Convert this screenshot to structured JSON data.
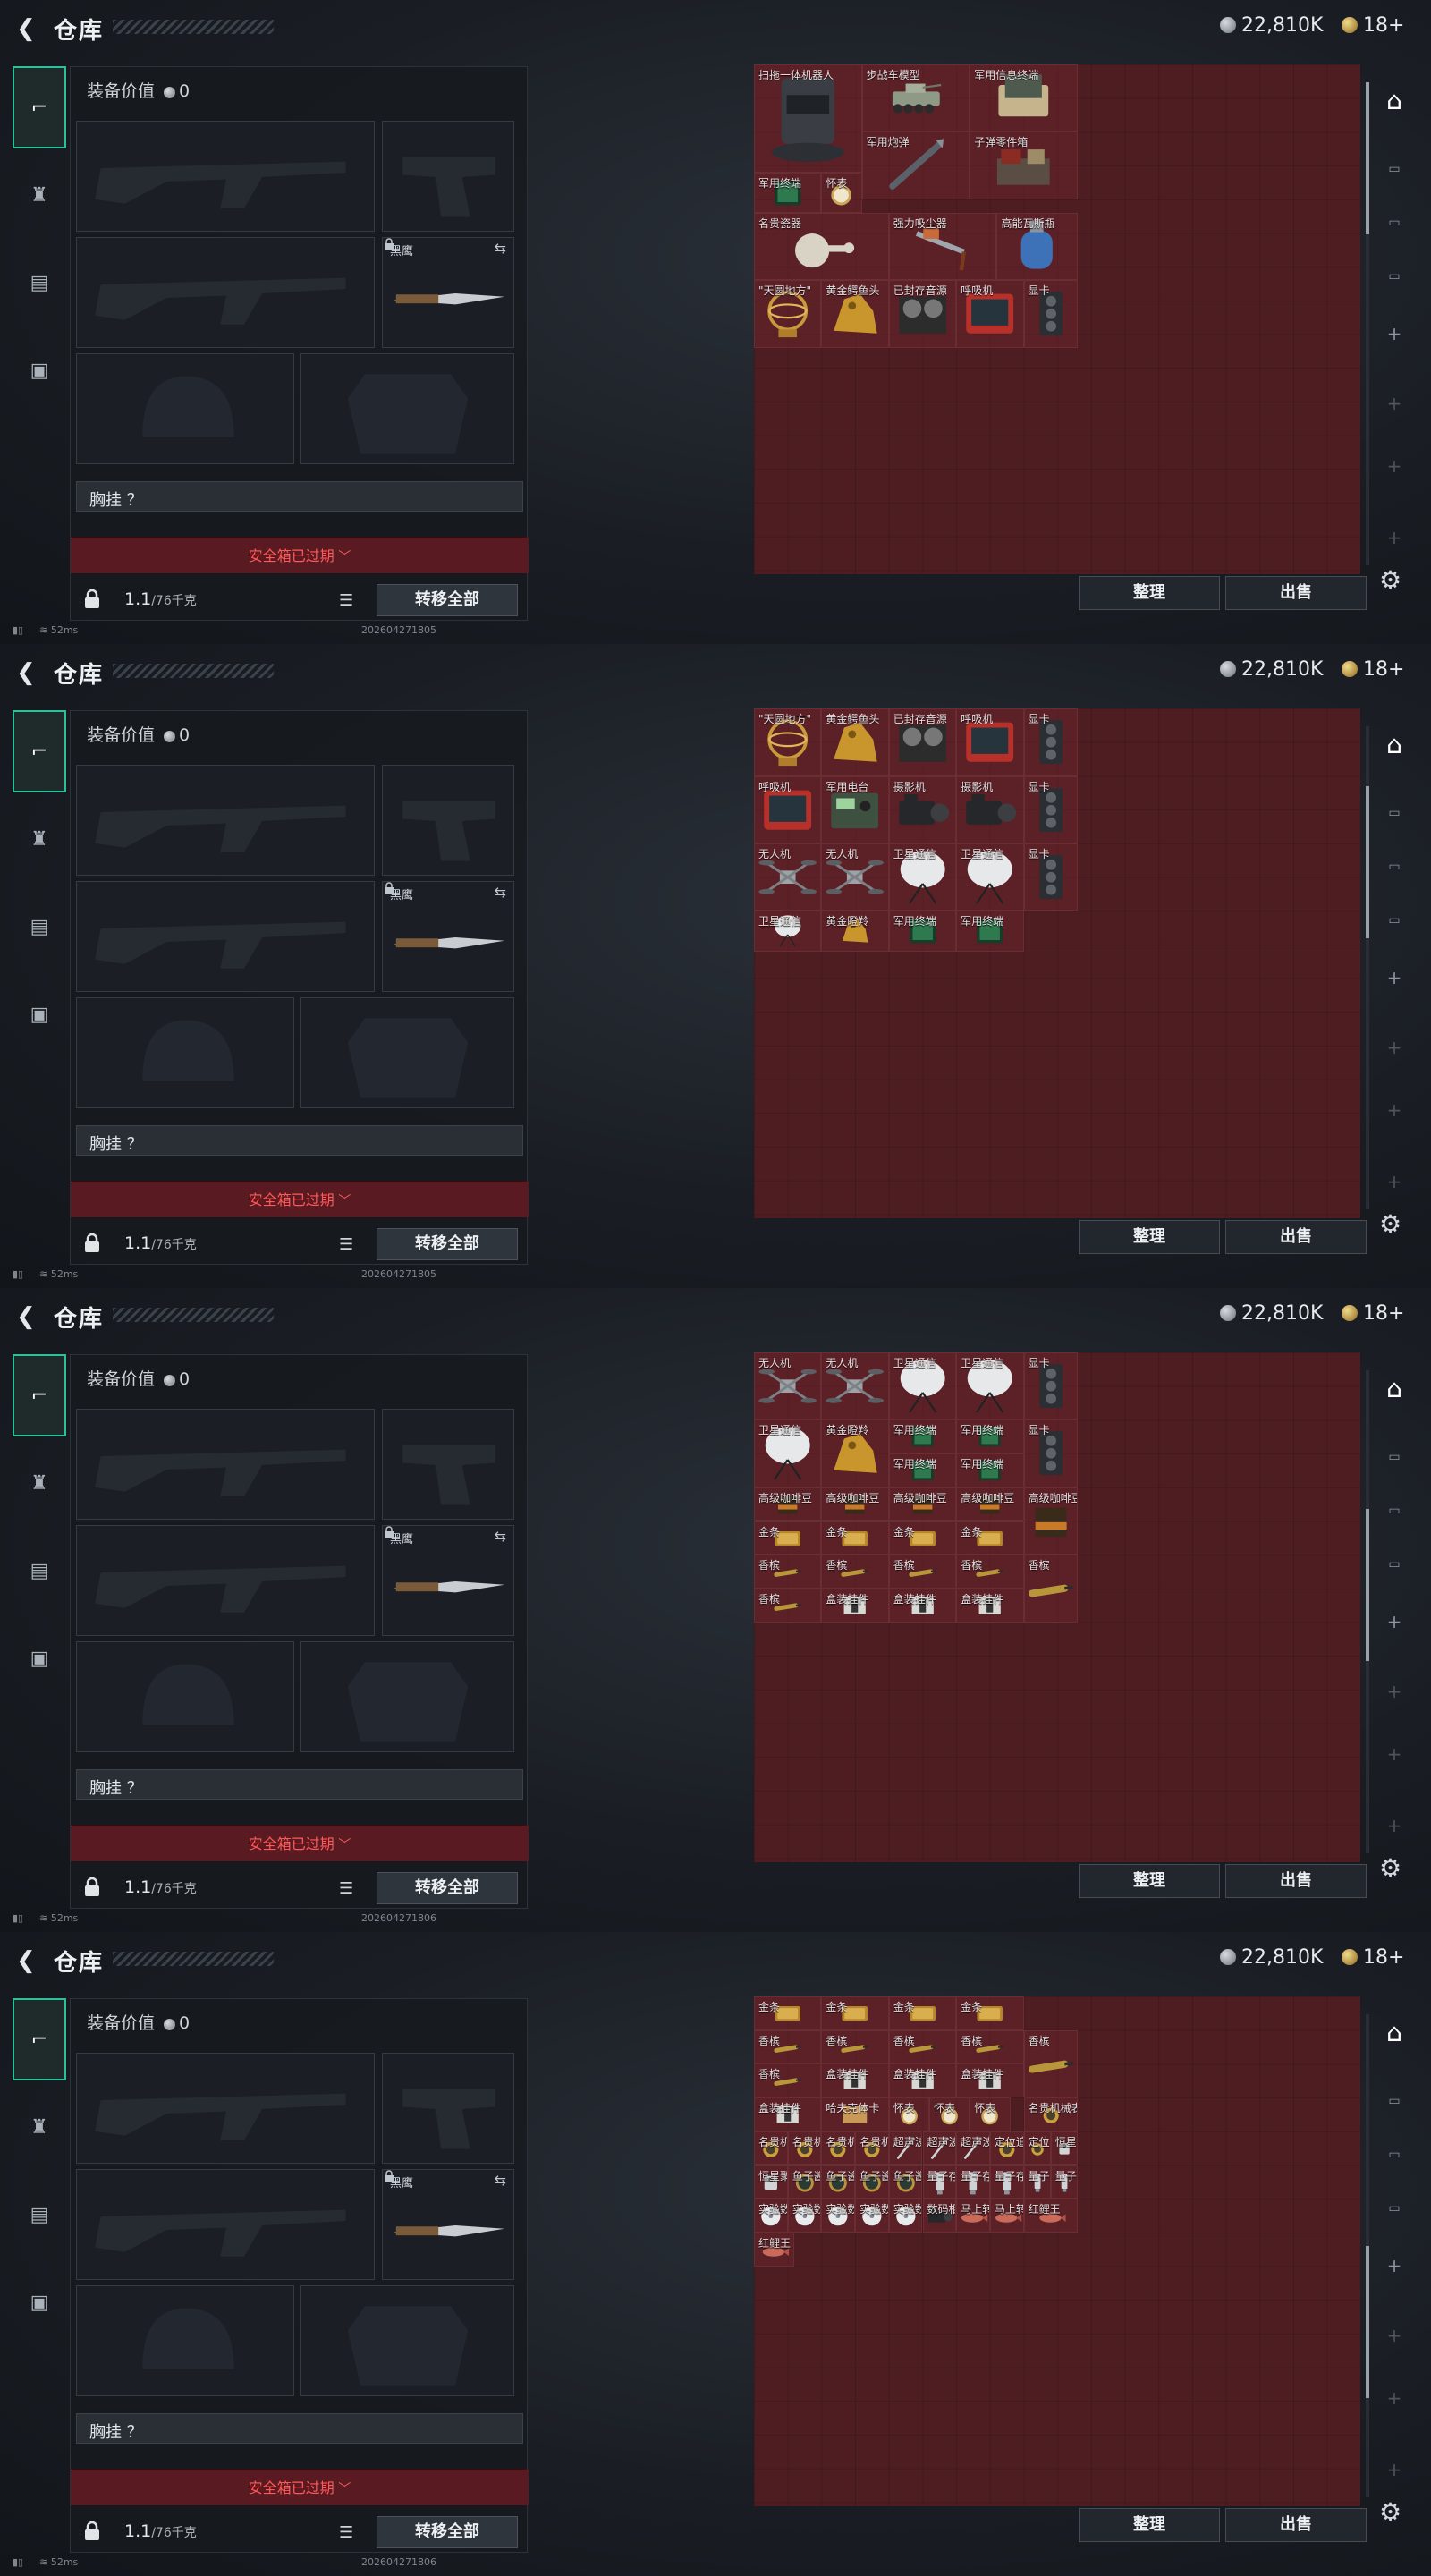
{
  "header": {
    "title": "仓库",
    "silver": "22,810K",
    "gold": "18+"
  },
  "equipment": {
    "value_label": "装备价值",
    "value": "0",
    "knife_label": "黑鹰",
    "chest_label": "胸挂 ？",
    "safebox_text": "安全箱已过期",
    "weight": "1.1",
    "weight_unit": "/76千克",
    "transfer_label": "转移全部"
  },
  "status": {
    "ping": "52ms",
    "build_1": "202604271805",
    "build_2": "202604271806"
  },
  "buttons": {
    "sort": "整理",
    "sell": "出售"
  },
  "icons": {
    "back": "back-arrow-icon",
    "silver": "silver-coin-icon",
    "gold": "gold-coin-icon",
    "weapon_tab": "gun-icon",
    "armor_tab": "armor-icon",
    "backpack_tab": "backpack-icon",
    "toolbox_tab": "briefcase-icon",
    "lock": "lock-icon",
    "list": "list-icon",
    "swap": "swap-icon",
    "gear": "gear-icon",
    "rail_main": "storage-icon",
    "rail_add": "plus-icon"
  },
  "panels": [
    {
      "scroll_thumb_fraction": 0.0,
      "items": [
        {
          "name": "扫拖一体机器人",
          "kind": "robot"
        },
        {
          "name": "步战车模型",
          "kind": "tank"
        },
        {
          "name": "军用信息终端",
          "kind": "terminal"
        },
        {
          "name": "军用炮弹",
          "kind": "shell"
        },
        {
          "name": "子弹零件箱",
          "kind": "crate"
        },
        {
          "name": "军用终端",
          "kind": "board"
        },
        {
          "name": "怀表",
          "kind": "watch"
        },
        {
          "name": "名贵瓷器",
          "kind": "vase"
        },
        {
          "name": "强力吸尘器",
          "kind": "vacuum"
        },
        {
          "name": "高能瓦斯瓶",
          "kind": "gas"
        },
        {
          "name": "\"天圆地方\"",
          "kind": "sphere"
        },
        {
          "name": "黄金鳄鱼头",
          "kind": "gold"
        },
        {
          "name": "已封存音源",
          "kind": "reel"
        },
        {
          "name": "呼吸机",
          "kind": "monitor"
        },
        {
          "name": "显卡",
          "kind": "gpu"
        }
      ]
    },
    {
      "scroll_thumb_fraction": 0.18,
      "items": [
        {
          "name": "\"天圆地方\"",
          "kind": "sphere"
        },
        {
          "name": "黄金鳄鱼头",
          "kind": "gold"
        },
        {
          "name": "已封存音源",
          "kind": "reel"
        },
        {
          "name": "呼吸机",
          "kind": "monitor"
        },
        {
          "name": "显卡",
          "kind": "gpu"
        },
        {
          "name": "呼吸机",
          "kind": "monitor"
        },
        {
          "name": "军用电台",
          "kind": "radio"
        },
        {
          "name": "摄影机",
          "kind": "camera"
        },
        {
          "name": "摄影机",
          "kind": "camera"
        },
        {
          "name": "显卡",
          "kind": "gpu"
        },
        {
          "name": "无人机",
          "kind": "drone"
        },
        {
          "name": "无人机",
          "kind": "drone"
        },
        {
          "name": "卫星通信",
          "kind": "dish"
        },
        {
          "name": "卫星通信",
          "kind": "dish"
        },
        {
          "name": "显卡",
          "kind": "gpu"
        },
        {
          "name": "卫星通信",
          "kind": "dish"
        },
        {
          "name": "黄金瞪羚",
          "kind": "gold"
        },
        {
          "name": "军用终端",
          "kind": "board"
        },
        {
          "name": "军用终端",
          "kind": "board"
        }
      ]
    },
    {
      "scroll_thumb_fraction": 0.42,
      "items": [
        {
          "name": "无人机",
          "kind": "drone"
        },
        {
          "name": "无人机",
          "kind": "drone"
        },
        {
          "name": "卫星通信",
          "kind": "dish"
        },
        {
          "name": "卫星通信",
          "kind": "dish"
        },
        {
          "name": "显卡",
          "kind": "gpu"
        },
        {
          "name": "卫星通信",
          "kind": "dish"
        },
        {
          "name": "黄金瞪羚",
          "kind": "gold"
        },
        {
          "name": "军用终端",
          "kind": "board"
        },
        {
          "name": "军用终端",
          "kind": "board"
        },
        {
          "name": "显卡",
          "kind": "gpu"
        },
        {
          "name": "军用终端",
          "kind": "board"
        },
        {
          "name": "军用终端",
          "kind": "board"
        },
        {
          "name": "高级咖啡豆",
          "kind": "coffee"
        },
        {
          "name": "高级咖啡豆",
          "kind": "coffee"
        },
        {
          "name": "高级咖啡豆",
          "kind": "coffee"
        },
        {
          "name": "高级咖啡豆",
          "kind": "coffee"
        },
        {
          "name": "高级咖啡豆",
          "kind": "coffee"
        },
        {
          "name": "金条",
          "kind": "bar"
        },
        {
          "name": "金条",
          "kind": "bar"
        },
        {
          "name": "金条",
          "kind": "bar"
        },
        {
          "name": "金条",
          "kind": "bar"
        },
        {
          "name": "香槟",
          "kind": "bottle"
        },
        {
          "name": "香槟",
          "kind": "bottle"
        },
        {
          "name": "香槟",
          "kind": "bottle"
        },
        {
          "name": "香槟",
          "kind": "bottle"
        },
        {
          "name": "香槟",
          "kind": "bottle"
        },
        {
          "name": "香槟",
          "kind": "bottle"
        },
        {
          "name": "盒装挂件",
          "kind": "box"
        },
        {
          "name": "盒装挂件",
          "kind": "box"
        },
        {
          "name": "盒装挂件",
          "kind": "box"
        }
      ]
    },
    {
      "scroll_thumb_fraction": 0.7,
      "items": [
        {
          "name": "金条",
          "kind": "bar"
        },
        {
          "name": "金条",
          "kind": "bar"
        },
        {
          "name": "金条",
          "kind": "bar"
        },
        {
          "name": "金条",
          "kind": "bar"
        },
        {
          "name": "香槟",
          "kind": "bottle"
        },
        {
          "name": "香槟",
          "kind": "bottle"
        },
        {
          "name": "香槟",
          "kind": "bottle"
        },
        {
          "name": "香槟",
          "kind": "bottle"
        },
        {
          "name": "香槟",
          "kind": "bottle"
        },
        {
          "name": "香槟",
          "kind": "bottle"
        },
        {
          "name": "盒装挂件",
          "kind": "box"
        },
        {
          "name": "盒装挂件",
          "kind": "box"
        },
        {
          "name": "盒装挂件",
          "kind": "box"
        },
        {
          "name": "盒装挂件",
          "kind": "box"
        },
        {
          "name": "哈夫克体卡",
          "kind": "card"
        },
        {
          "name": "怀表",
          "kind": "watch"
        },
        {
          "name": "怀表",
          "kind": "watch"
        },
        {
          "name": "怀表",
          "kind": "watch"
        },
        {
          "name": "名贵机械表",
          "kind": "ring"
        },
        {
          "name": "名贵机械表",
          "kind": "ring"
        },
        {
          "name": "名贵机械表",
          "kind": "ring"
        },
        {
          "name": "名贵机械表",
          "kind": "ring"
        },
        {
          "name": "名贵机械表",
          "kind": "ring"
        },
        {
          "name": "超声波切...",
          "kind": "pen"
        },
        {
          "name": "超声波切...",
          "kind": "pen"
        },
        {
          "name": "超声波切...",
          "kind": "pen"
        },
        {
          "name": "定位追踪器",
          "kind": "ring"
        },
        {
          "name": "定位追踪器",
          "kind": "ring"
        },
        {
          "name": "恒星聚感器",
          "kind": "flash"
        },
        {
          "name": "恒星聚感器",
          "kind": "flash"
        },
        {
          "name": "鱼子酱",
          "kind": "tin"
        },
        {
          "name": "鱼子酱",
          "kind": "tin"
        },
        {
          "name": "鱼子酱",
          "kind": "tin"
        },
        {
          "name": "鱼子酱",
          "kind": "tin"
        },
        {
          "name": "量子存储",
          "kind": "usb"
        },
        {
          "name": "量子存储",
          "kind": "usb"
        },
        {
          "name": "量子存储",
          "kind": "usb"
        },
        {
          "name": "量子存储",
          "kind": "usb"
        },
        {
          "name": "量子存储",
          "kind": "usb"
        },
        {
          "name": "实验数据",
          "kind": "disc"
        },
        {
          "name": "实验数据",
          "kind": "disc"
        },
        {
          "name": "实验数据",
          "kind": "disc"
        },
        {
          "name": "实验数据",
          "kind": "disc"
        },
        {
          "name": "实验数据",
          "kind": "disc"
        },
        {
          "name": "数码相机",
          "kind": "camera"
        },
        {
          "name": "马上转运",
          "kind": "fish"
        },
        {
          "name": "马上转运",
          "kind": "fish"
        },
        {
          "name": "红鲤王",
          "kind": "fish"
        },
        {
          "name": "红鲤王",
          "kind": "fish"
        }
      ]
    }
  ]
}
